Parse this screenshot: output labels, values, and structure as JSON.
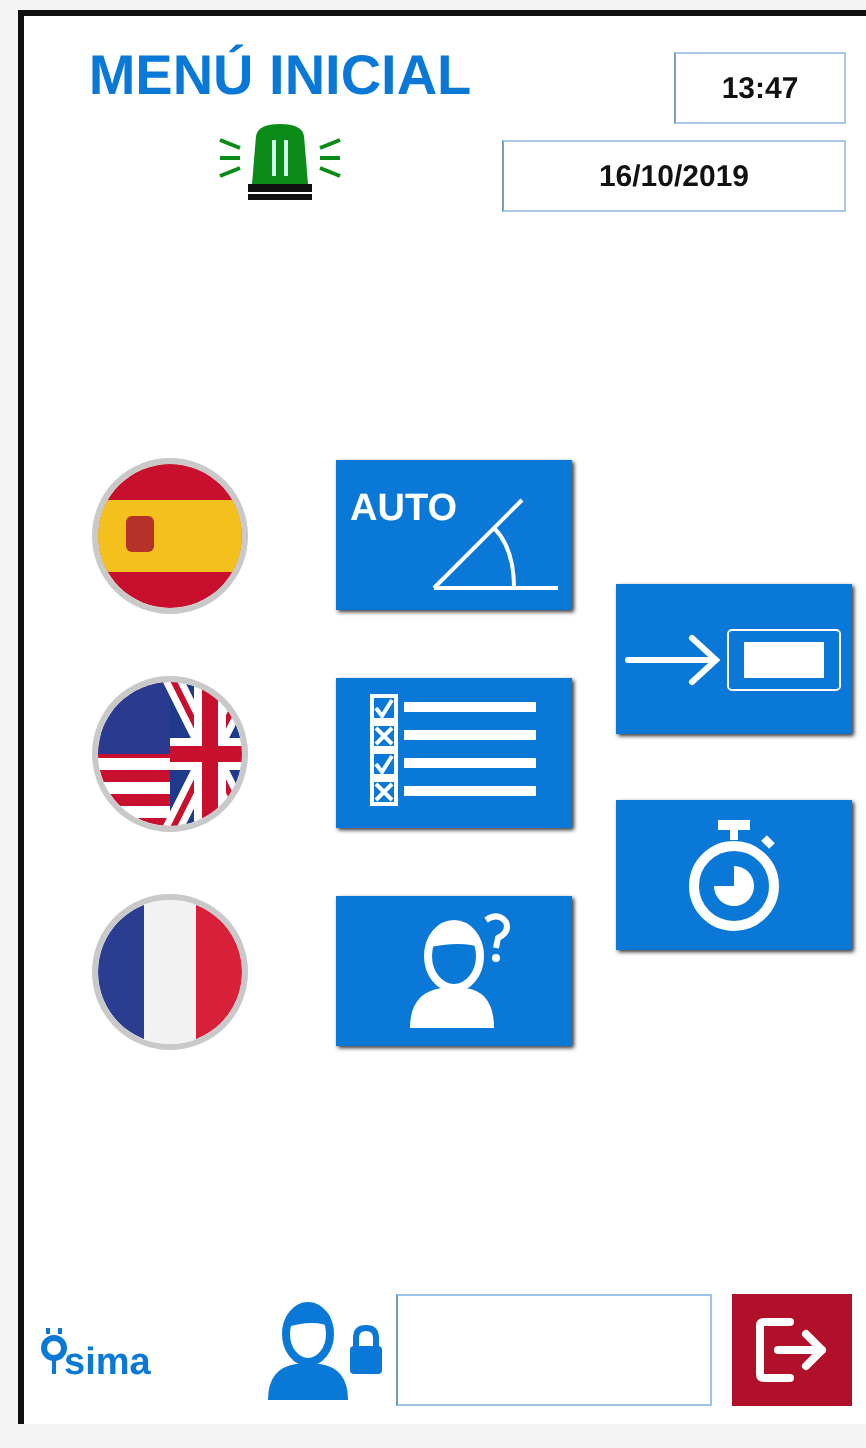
{
  "header": {
    "title": "MENÚ INICIAL",
    "time": "13:47",
    "date": "16/10/2019",
    "beacon": {
      "color": "#0a8a16"
    }
  },
  "languages": [
    {
      "kind": "spain"
    },
    {
      "kind": "us_uk"
    },
    {
      "kind": "france"
    }
  ],
  "menu_buttons": [
    {
      "kind": "auto_angle",
      "label": "AUTO"
    },
    {
      "kind": "checklist"
    },
    {
      "kind": "help_person"
    }
  ],
  "side_buttons": [
    {
      "kind": "arrow_into_field"
    },
    {
      "kind": "stopwatch"
    }
  ],
  "footer": {
    "logo": "sima",
    "exit": {
      "kind": "exit"
    }
  }
}
